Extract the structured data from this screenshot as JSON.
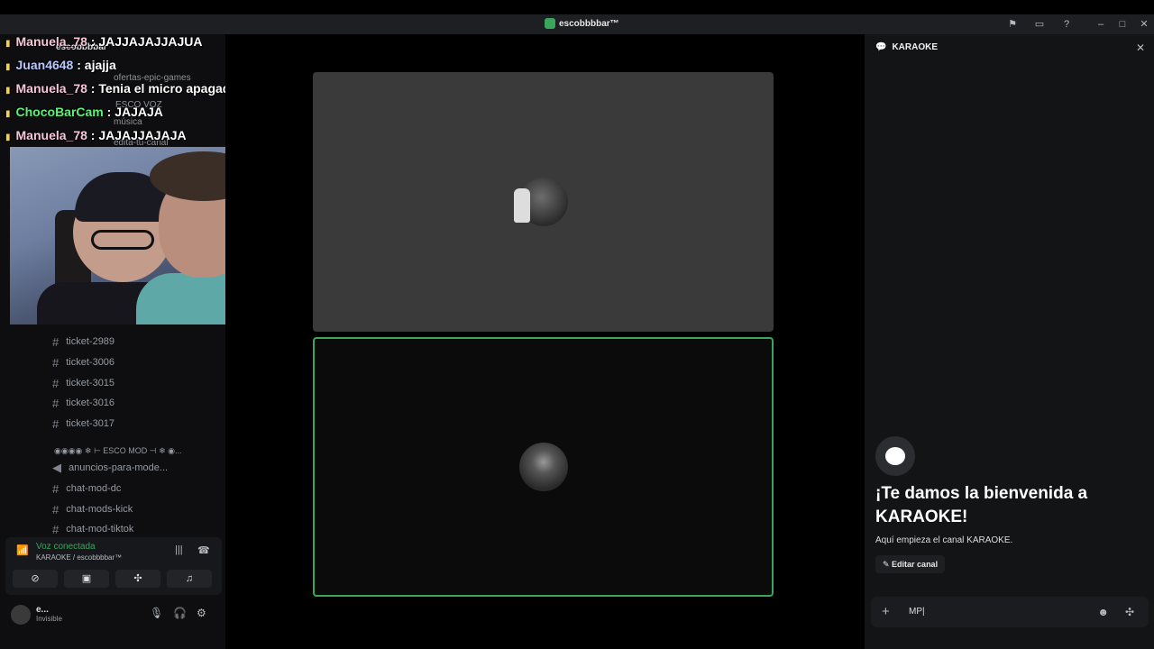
{
  "window": {
    "title": "escobbbbar™"
  },
  "overlay_chat": [
    {
      "name": "Manuela_78",
      "text": " : JAJJAJAJJAJUA",
      "color": "pink"
    },
    {
      "name": "Juan4648",
      "text": " : ajajja",
      "color": "blue"
    },
    {
      "name": "Manuela_78",
      "text": " : Tenia el micro apagado",
      "color": "pink"
    },
    {
      "name": "ChocoBarCam",
      "text": " : JAJAJA",
      "color": "green"
    },
    {
      "name": "Manuela_78",
      "text": " : JAJAJJAJAJA",
      "color": "pink"
    }
  ],
  "faint_labels": {
    "server": "escobbbbar",
    "ch1": "ofertas-epic-games",
    "cat1": "ESCO VOZ",
    "ch2": "música",
    "ch3": "edita-tu-canal"
  },
  "channels": [
    "ticket-2989",
    "ticket-3006",
    "ticket-3015",
    "ticket-3016",
    "ticket-3017"
  ],
  "mod_category": "◉◉◉◉ ❄ ⊢ ESCO MOD ⊣ ❄ ◉...",
  "mod_channels": [
    "anuncios-para-mode...",
    "chat-mod-dc",
    "chat-mods-kick",
    "chat-mod-tiktok"
  ],
  "voice": {
    "status": "Voz conectada",
    "location": "KARAOKE / escobbbbar™"
  },
  "user": {
    "name": "e...",
    "status": "Invisible"
  },
  "panel": {
    "title": "KARAOKE",
    "welcome": "¡Te damos la bienvenida a KARAOKE!",
    "start": "Aquí empieza el canal KARAOKE.",
    "edit": "Editar canal",
    "composer_text": "MP|"
  },
  "colors": {
    "accent_green": "#3ba55c",
    "background": "#000000"
  }
}
